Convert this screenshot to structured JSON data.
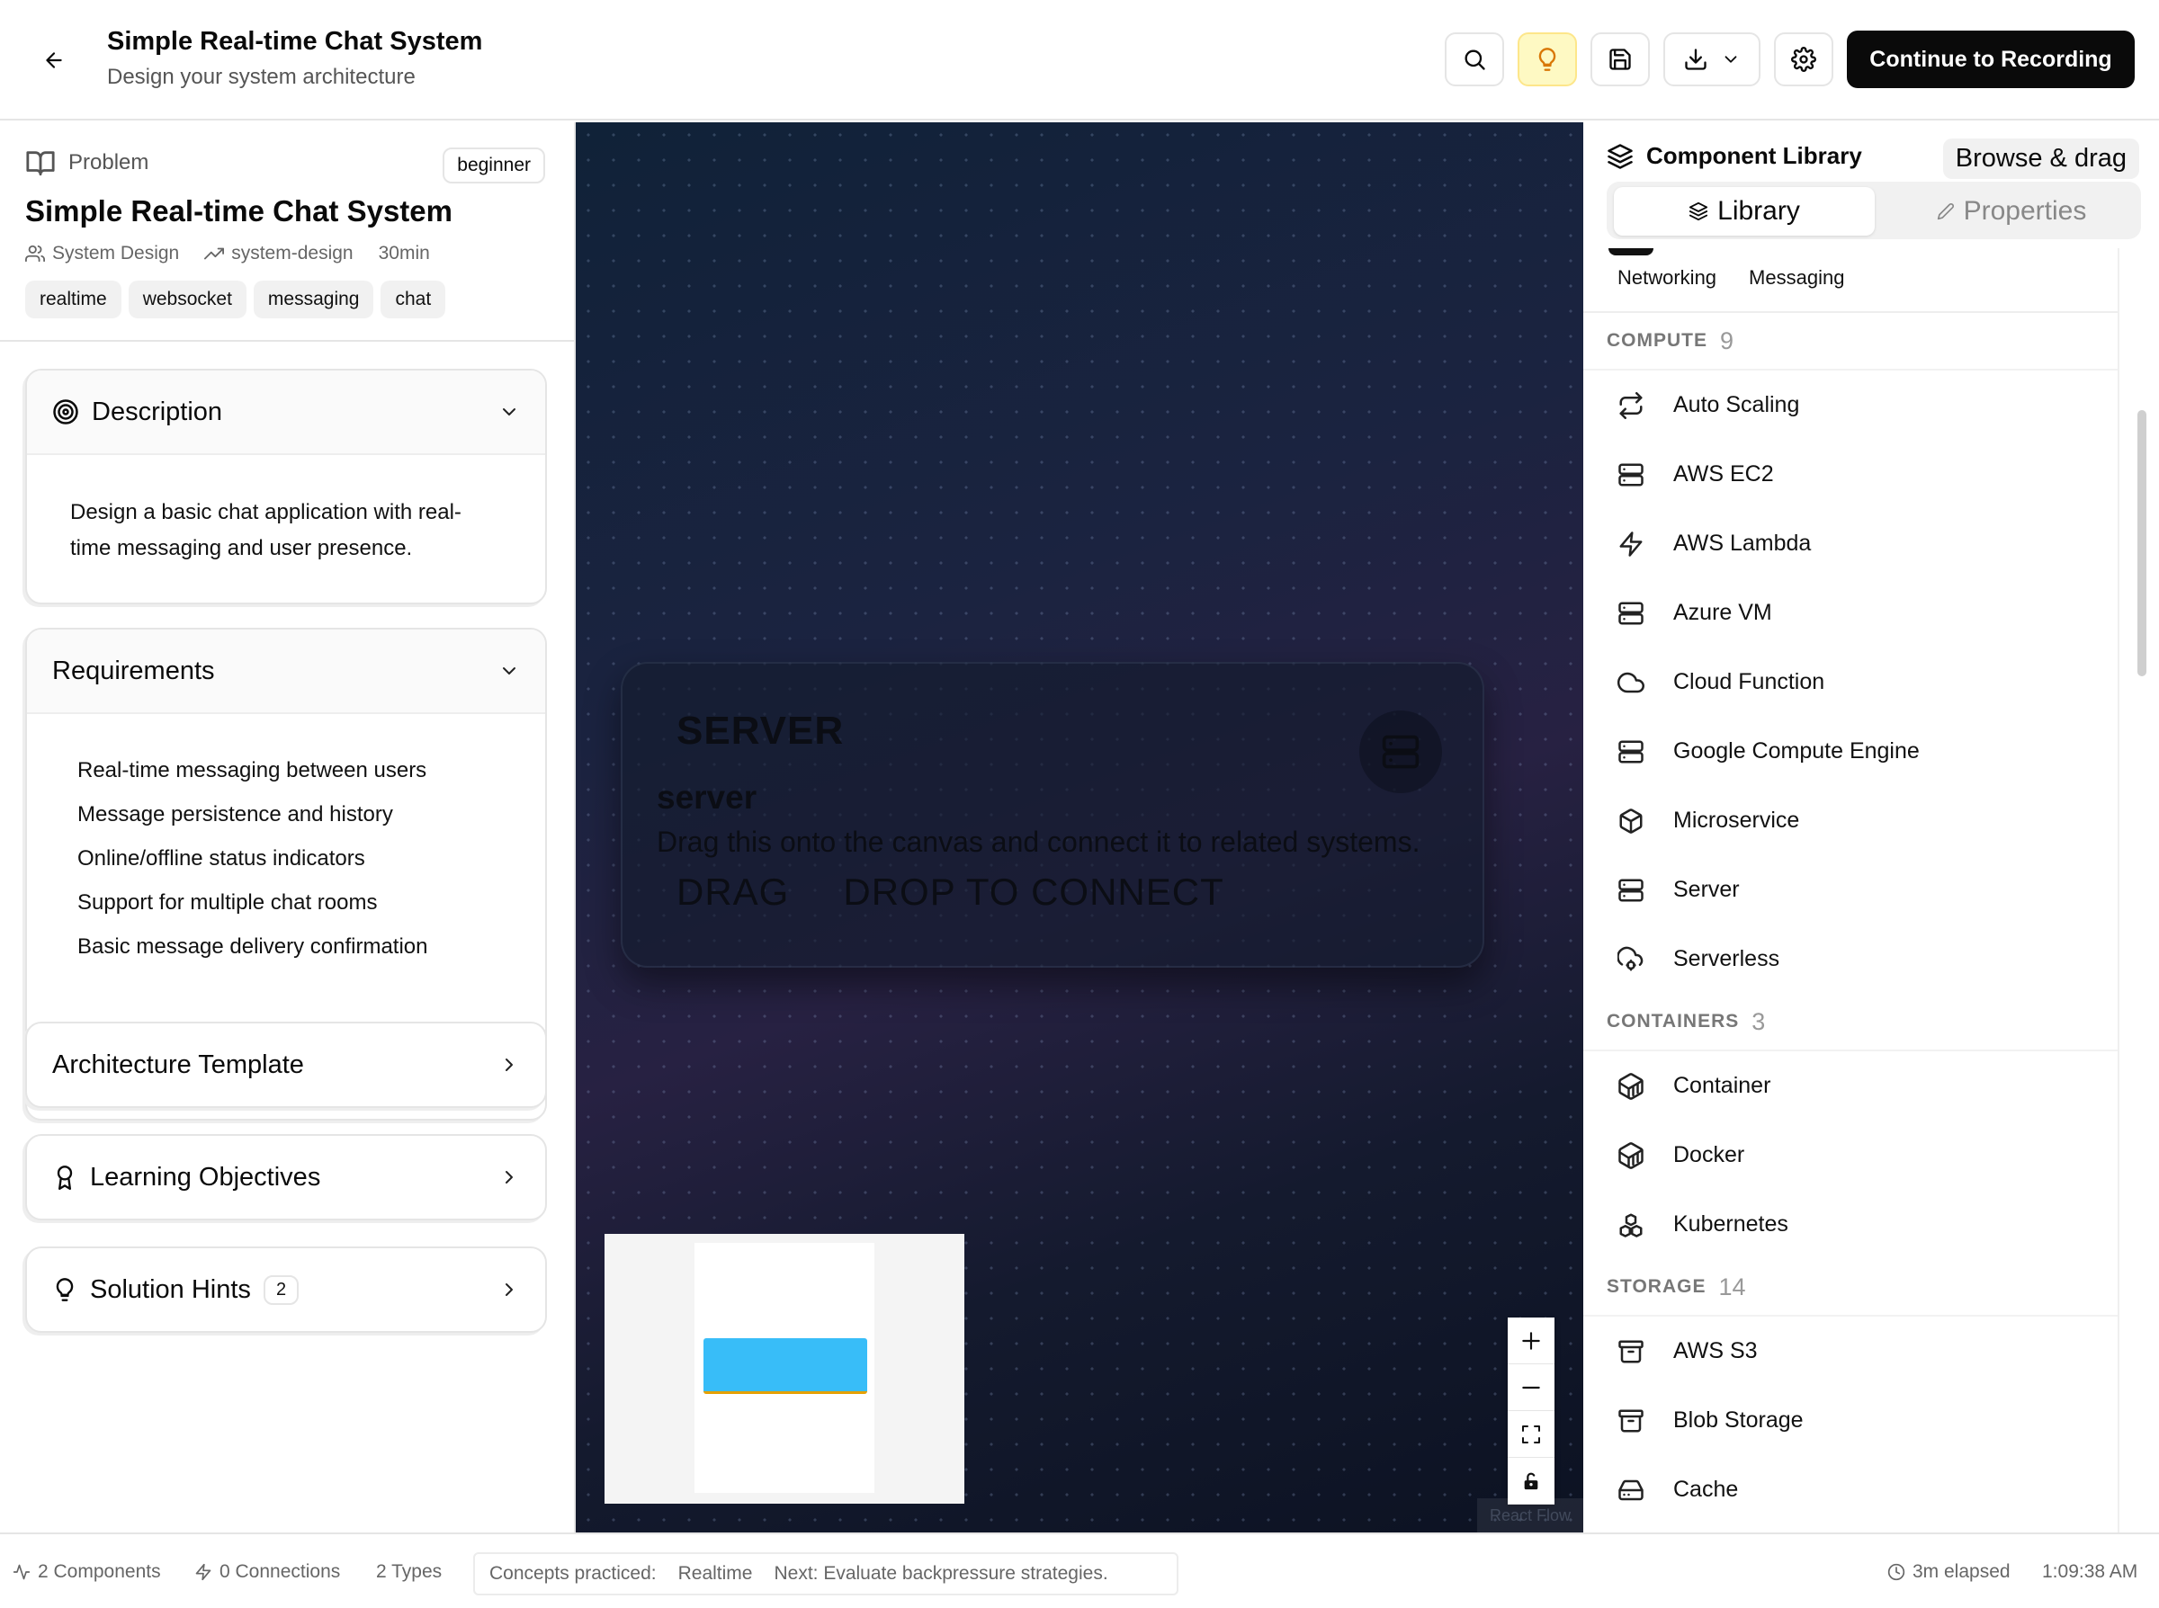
{
  "header": {
    "title": "Simple Real-time Chat System",
    "subtitle": "Design your system architecture",
    "continue_label": "Continue to Recording"
  },
  "problem": {
    "label": "Problem",
    "level": "beginner",
    "title": "Simple Real-time Chat System",
    "category": "System Design",
    "type": "system-design",
    "duration": "30min",
    "tags": [
      "realtime",
      "websocket",
      "messaging",
      "chat"
    ]
  },
  "sections": {
    "description": {
      "title": "Description",
      "text": "Design a basic chat application with real-time messaging and user presence."
    },
    "requirements": {
      "title": "Requirements",
      "items": [
        "Real-time messaging between users",
        "Message persistence and history",
        "Online/offline status indicators",
        "Support for multiple chat rooms",
        "Basic message delivery confirmation"
      ]
    },
    "architecture": {
      "title": "Architecture Template"
    },
    "learning": {
      "title": "Learning Objectives"
    },
    "hints": {
      "title": "Solution Hints",
      "count": "2"
    }
  },
  "canvas": {
    "node": {
      "heading": "SERVER",
      "name": "server",
      "description": "Drag this onto the canvas and connect it to related systems.",
      "tag_drag": "DRAG",
      "tag_drop": "DROP TO CONNECT"
    },
    "attribution": "React Flow"
  },
  "library": {
    "title": "Component Library",
    "badge": "Browse & drag",
    "tab_library": "Library",
    "tab_properties": "Properties",
    "filters": [
      "Networking",
      "Messaging"
    ],
    "groups": [
      {
        "name": "COMPUTE",
        "count": "9",
        "items": [
          {
            "label": "Auto Scaling",
            "icon": "repeat-icon"
          },
          {
            "label": "AWS EC2",
            "icon": "server-icon"
          },
          {
            "label": "AWS Lambda",
            "icon": "zap-icon"
          },
          {
            "label": "Azure VM",
            "icon": "server-icon"
          },
          {
            "label": "Cloud Function",
            "icon": "cloud-icon"
          },
          {
            "label": "Google Compute Engine",
            "icon": "server-icon"
          },
          {
            "label": "Microservice",
            "icon": "box-icon"
          },
          {
            "label": "Server",
            "icon": "server-icon"
          },
          {
            "label": "Serverless",
            "icon": "cloud-cog-icon"
          }
        ]
      },
      {
        "name": "CONTAINERS",
        "count": "3",
        "items": [
          {
            "label": "Container",
            "icon": "container-icon"
          },
          {
            "label": "Docker",
            "icon": "container-icon"
          },
          {
            "label": "Kubernetes",
            "icon": "boxes-icon"
          }
        ]
      },
      {
        "name": "STORAGE",
        "count": "14",
        "items": [
          {
            "label": "AWS S3",
            "icon": "archive-icon"
          },
          {
            "label": "Blob Storage",
            "icon": "archive-icon"
          },
          {
            "label": "Cache",
            "icon": "hard-drive-icon"
          }
        ]
      }
    ]
  },
  "footer": {
    "components": "2 Components",
    "connections": "0 Connections",
    "types": "2 Types",
    "concepts_label": "Concepts practiced:",
    "concepts_value": "Realtime",
    "next": "Next: Evaluate backpressure strategies.",
    "elapsed": "3m elapsed",
    "clock": "1:09:38 AM"
  },
  "colors": {
    "accent_dark": "#0a0a0a",
    "hint_bg": "#fef9c3",
    "minimap_node": "#38bdf8"
  }
}
